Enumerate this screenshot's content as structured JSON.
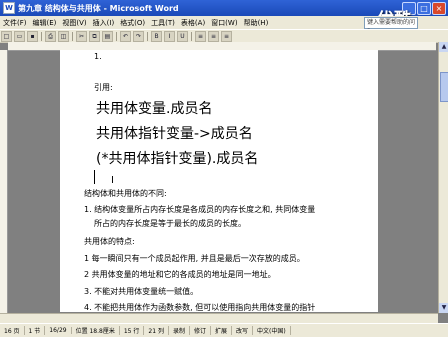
{
  "window": {
    "title": "第九章 结构体与共用体 - Microsoft Word",
    "min": "_",
    "max": "□",
    "close": "×"
  },
  "menu": [
    "文件(F)",
    "编辑(E)",
    "视图(V)",
    "插入(I)",
    "格式(O)",
    "工具(T)",
    "表格(A)",
    "窗口(W)",
    "帮助(H)"
  ],
  "help_box": "键入需要帮助的问题",
  "logo": "优酷",
  "doc": {
    "l1": "1.",
    "l2": "引用:",
    "l3": "共用体变量.成员名",
    "l4": "共用体指针变量->成员名",
    "l5": "(*共用体指针变量).成员名",
    "l6": "结构体和共用体的不同:",
    "l7": "1. 结构体变量所占内存长度是各成员的内存长度之和, 共同体变量",
    "l8": "所占的内存长度是等于最长的成员的长度。",
    "l9": "共用体的特点:",
    "l10": "1 每一瞬间只有一个成员起作用, 并且是最后一次存放的成员。",
    "l11": "2 共用体变量的地址和它的各成员的地址是同一地址。",
    "l12": "3. 不能对共用体变量统一赋值。",
    "l13": "4. 不能把共用体作为函数参数, 但可以使用指向共用体变量的指针"
  },
  "status": {
    "page": "16 页",
    "section": "1 节",
    "pages": "16/29",
    "pos": "位置 18.8厘米",
    "line": "15 行",
    "col": "21 列",
    "rec": "录制",
    "rev": "修订",
    "ext": "扩展",
    "ovr": "改写",
    "lang": "中文(中国)"
  }
}
